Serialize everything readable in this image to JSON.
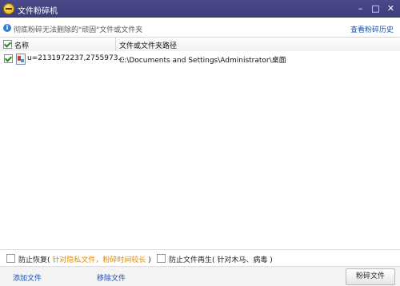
{
  "window": {
    "title": "文件粉碎机",
    "controls": {
      "minimize": "–",
      "maximize": "□",
      "close": "✕"
    }
  },
  "toolbar": {
    "hint": "彻底粉碎无法删除的\"顽固\"文件或文件夹",
    "history_link": "查看粉碎历史"
  },
  "table": {
    "columns": [
      "名称",
      "文件或文件夹路径"
    ],
    "rows": [
      {
        "checked": true,
        "name": "u=2131972237,2755973...",
        "path": "C:\\Documents and Settings\\Administrator\\桌面"
      }
    ]
  },
  "options": {
    "prevent_recovery": {
      "label": "防止恢复",
      "note": "针对隐私文件，粉碎时间较长",
      "checked": false
    },
    "prevent_regenerate": {
      "label": "防止文件再生",
      "note": "针对木马、病毒",
      "checked": false
    }
  },
  "footer": {
    "add_file": "添加文件",
    "remove_file": "移除文件",
    "shred_button": "粉碎文件"
  }
}
